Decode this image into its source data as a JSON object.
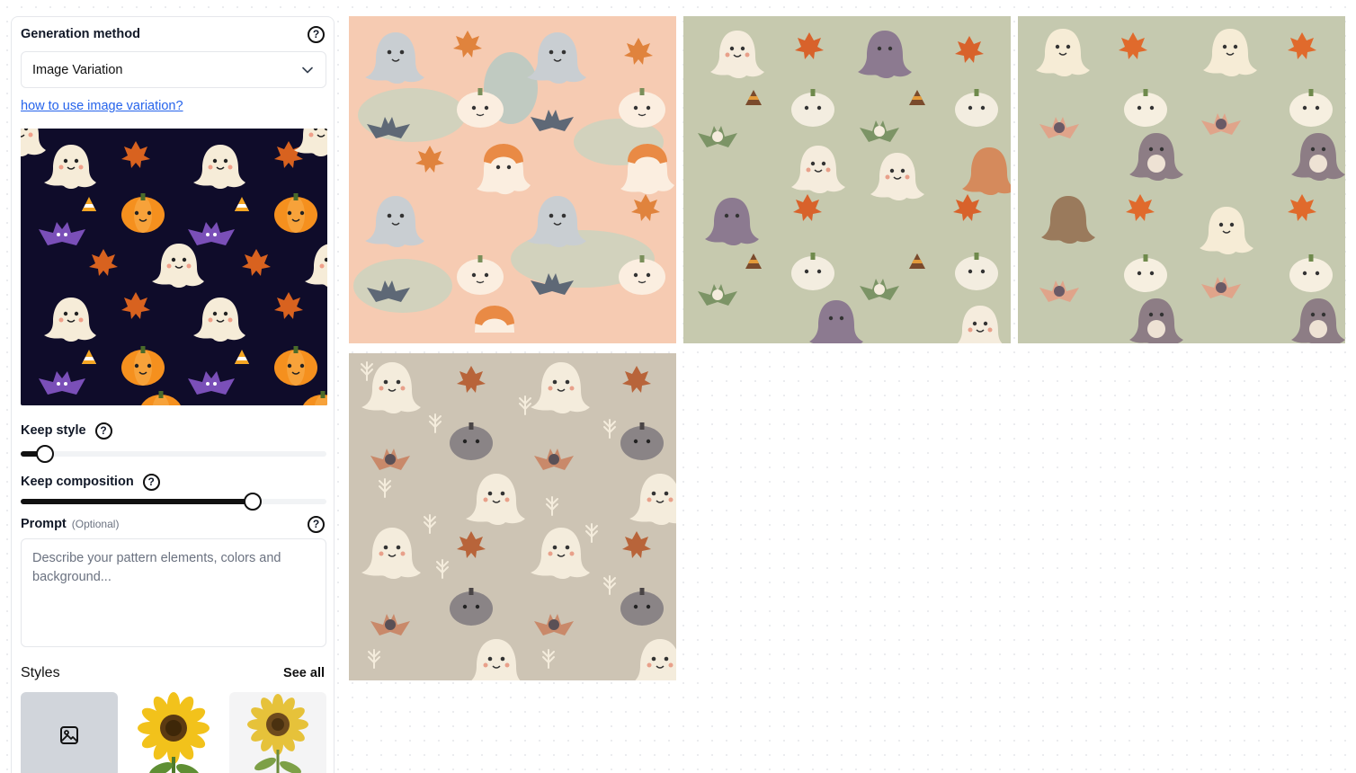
{
  "panel": {
    "generation_method": {
      "label": "Generation method",
      "selected": "Image Variation"
    },
    "help_link": "how to use image variation?",
    "keep_style": {
      "label": "Keep style",
      "level": 0.08
    },
    "keep_composition": {
      "label": "Keep composition",
      "level": 0.76
    },
    "prompt": {
      "label": "Prompt",
      "optional_label": "(Optional)",
      "placeholder": "Describe your pattern elements, colors and background..."
    },
    "styles": {
      "title": "Styles",
      "see_all": "See all",
      "tiles": [
        "upload-image",
        "sunflower-1",
        "sunflower-2"
      ]
    },
    "icons": [
      "help-icon",
      "chevron-down-icon",
      "image-upload-icon"
    ]
  },
  "results": [
    {
      "name": "result-1",
      "background": "#f6cbb2"
    },
    {
      "name": "result-2",
      "background": "#c6c9ae"
    },
    {
      "name": "result-3",
      "background": "#c5c9af"
    },
    {
      "name": "result-4",
      "background": "#cdc4b4"
    }
  ],
  "colors": {
    "accent_link": "#2563eb",
    "preview_background": "#0f0c2a",
    "slider_fill": "#111111",
    "tile_upload_bg": "#d1d5db"
  }
}
